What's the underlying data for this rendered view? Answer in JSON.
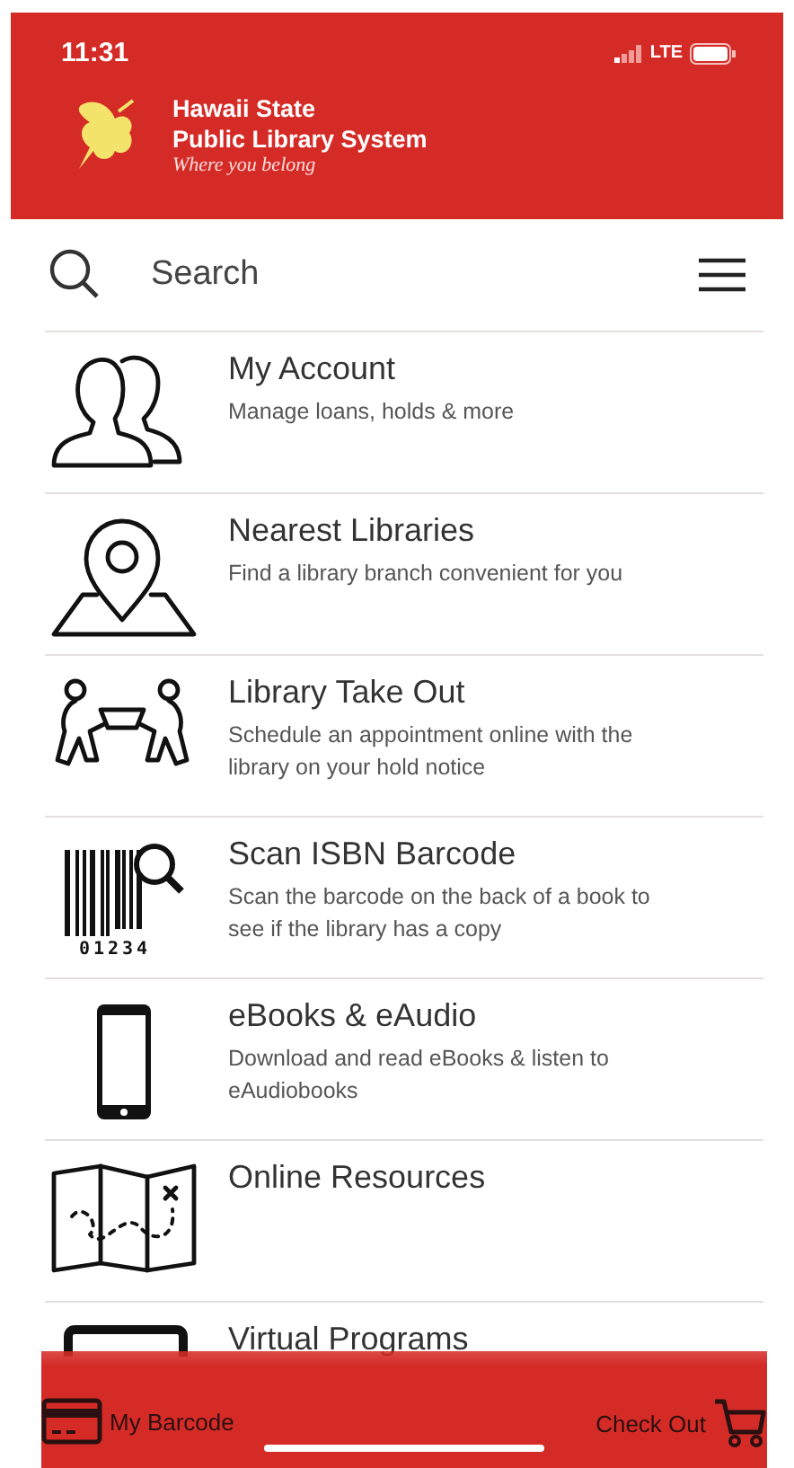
{
  "status_bar": {
    "time": "11:31",
    "network": "LTE"
  },
  "header": {
    "title_line_1": "Hawaii State",
    "title_line_2": "Public Library System",
    "tagline": "Where you belong"
  },
  "search": {
    "placeholder": "Search"
  },
  "menu_items": [
    {
      "kind": "account",
      "title": "My Account",
      "subtitle": "Manage loans, holds & more"
    },
    {
      "kind": "location",
      "title": "Nearest Libraries",
      "subtitle": "Find a library branch convenient for you"
    },
    {
      "kind": "takeout",
      "title": "Library Take Out",
      "subtitle": "Schedule an appointment online with the library on your hold notice"
    },
    {
      "kind": "barcode",
      "title": "Scan ISBN Barcode",
      "subtitle": "Scan the barcode on the back of a book to see if the library has a copy",
      "icon_text": "01234"
    },
    {
      "kind": "ebook",
      "title": "eBooks & eAudio",
      "subtitle": "Download and read eBooks & listen to eAudiobooks"
    },
    {
      "kind": "map",
      "title": "Online Resources"
    },
    {
      "kind": "screen",
      "title": "Virtual Programs"
    }
  ],
  "bottom_bar": {
    "left": "My Barcode",
    "right": "Check Out"
  }
}
